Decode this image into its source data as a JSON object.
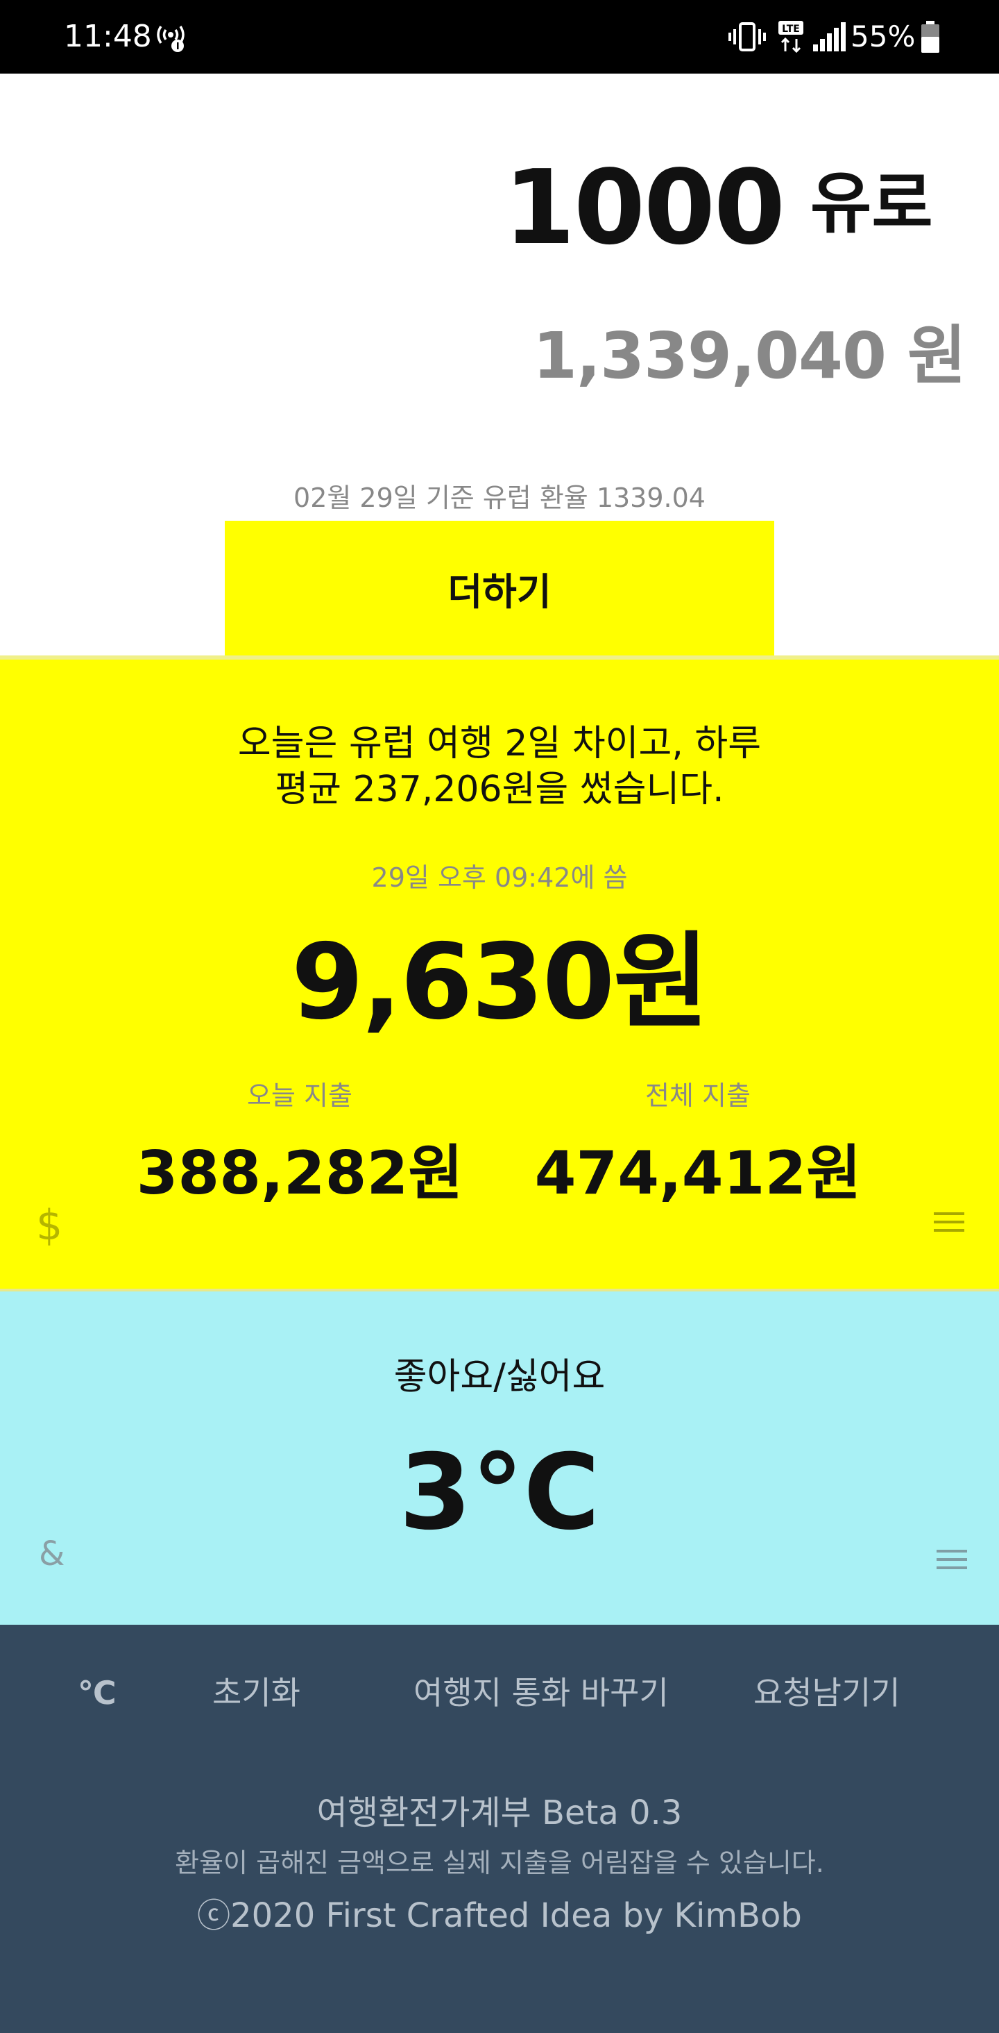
{
  "status_bar": {
    "time": "11:48",
    "battery_percent": "55%",
    "icons": [
      "hotspot-icon",
      "vibrate-icon",
      "lte-icon",
      "signal-icon",
      "battery-icon"
    ],
    "battery_level": 0.55
  },
  "converter": {
    "amount": "1000",
    "currency": "유로",
    "converted": "1,339,040 원",
    "rate_info": "02월 29일 기준 유럽 환율 1339.04",
    "add_button_label": "더하기"
  },
  "expense": {
    "summary_line1": "오늘은 유럽 여행 2일 차이고, 하루",
    "summary_line2": "평균 237,206원을 썼습니다.",
    "last_spent_time": "29일 오후 09:42에 씀",
    "last_amount": "9,630원",
    "today_label": "오늘 지출",
    "today_value": "388,282원",
    "total_label": "전체 지출",
    "total_value": "474,412원",
    "left_icon_glyph": "$"
  },
  "weather": {
    "label": "좋아요/싫어요",
    "temperature": "3°C",
    "left_icon_glyph": "&"
  },
  "footer": {
    "links": {
      "unit_toggle": "℃",
      "reset": "초기화",
      "change_currency": "여행지 통화 바꾸기",
      "request": "요청남기기"
    },
    "app_version": "여행환전가계부 Beta 0.3",
    "disclaimer": "환율이 곱해진 금액으로 실제 지출을 어림잡을 수 있습니다.",
    "copyright": "ⓒ2020 First Crafted Idea by KimBob"
  },
  "colors": {
    "status_bar_bg": "#000000",
    "accent_yellow": "#ffff00",
    "weather_bg": "#a9f1f5",
    "footer_bg": "#34495e",
    "muted_text": "#888888"
  }
}
